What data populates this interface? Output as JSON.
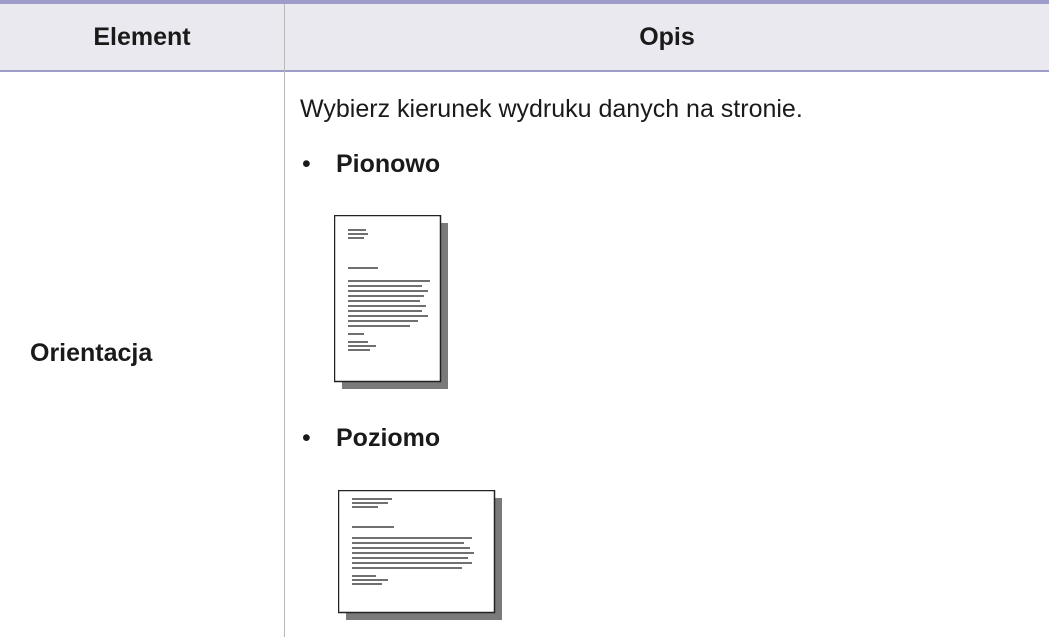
{
  "table": {
    "header": {
      "element": "Element",
      "opis": "Opis"
    },
    "rows": [
      {
        "element": "Orientacja",
        "description": "Wybierz kierunek wydruku danych na stronie.",
        "options": [
          {
            "label": "Pionowo",
            "icon": "portrait-page-icon"
          },
          {
            "label": "Poziomo",
            "icon": "landscape-page-icon"
          }
        ],
        "bullet": "•"
      }
    ]
  },
  "colors": {
    "header_background": "#e9e9ef",
    "header_rule": "#9e9cc8",
    "text": "#1a1a1a",
    "divider": "#b8b8b8"
  }
}
